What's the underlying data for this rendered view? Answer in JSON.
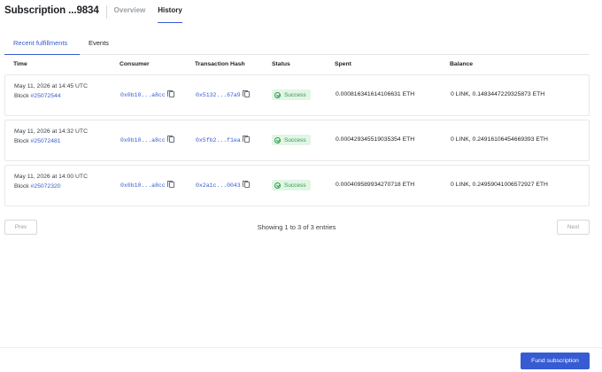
{
  "header": {
    "title": "Subscription ...9834",
    "tabs": [
      {
        "label": "Overview",
        "active": false
      },
      {
        "label": "History",
        "active": true
      }
    ]
  },
  "subtabs": [
    {
      "label": "Recent fulfillments",
      "active": true
    },
    {
      "label": "Events",
      "active": false
    }
  ],
  "table": {
    "columns": [
      "Time",
      "Consumer",
      "Transaction Hash",
      "Status",
      "Spent",
      "Balance"
    ],
    "block_prefix": "Block ",
    "rows": [
      {
        "time": "May 11, 2026 at 14:45 UTC",
        "block": "#25072544",
        "consumer": "0x0b10...a8cc",
        "tx_hash": "0x5132...67a9",
        "status": "Success",
        "spent": "0.000816341614106631 ETH",
        "balance": "0 LINK, 0.1483447229325873 ETH"
      },
      {
        "time": "May 11, 2026 at 14:32 UTC",
        "block": "#25072481",
        "consumer": "0x0b10...a8cc",
        "tx_hash": "0x5fb2...f1ea",
        "status": "Success",
        "spent": "0.000429345519035354 ETH",
        "balance": "0 LINK, 0.24916106454669393 ETH"
      },
      {
        "time": "May 11, 2026 at 14:00 UTC",
        "block": "#25072320",
        "consumer": "0x0b10...a8cc",
        "tx_hash": "0x2a1c...0043",
        "status": "Success",
        "spent": "0.000409589934270718 ETH",
        "balance": "0 LINK, 0.24959041006572927 ETH"
      }
    ]
  },
  "pagination": {
    "prev_label": "Prev",
    "next_label": "Next",
    "showing_text": "Showing 1 to 3 of 3 entries"
  },
  "footer": {
    "fund_button_label": "Fund subscription"
  },
  "colors": {
    "accent": "#375bd2",
    "success_bg": "#e3f5e6",
    "success_text": "#2f9e4b"
  }
}
